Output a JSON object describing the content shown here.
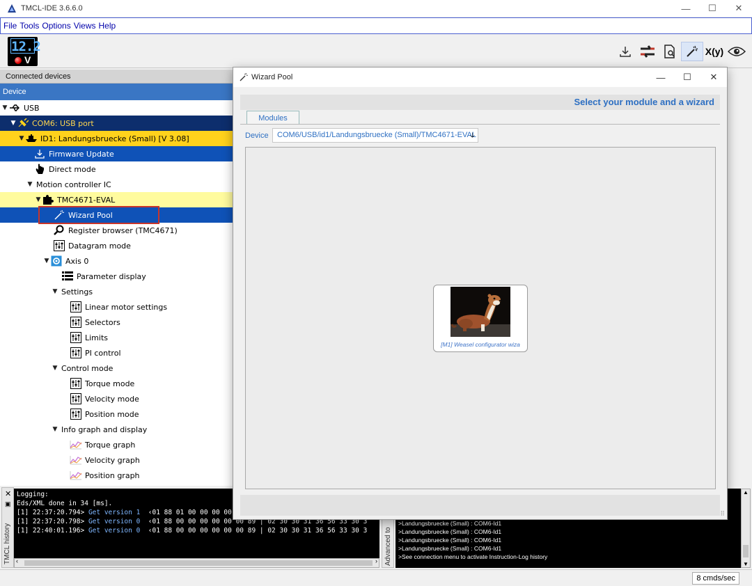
{
  "window": {
    "title": "TMCL-IDE 3.6.6.0",
    "controls": {
      "minimize": "—",
      "maximize": "☐",
      "close": "✕"
    }
  },
  "menu": [
    "File",
    "Tools",
    "Options",
    "Views",
    "Help"
  ],
  "toolbar": {
    "voltage_display": "12.2",
    "voltage_unit": "V",
    "xy_label": "X(y)"
  },
  "left_panel": {
    "header": "Connected devices",
    "column_header": "Device",
    "tree": {
      "usb": "USB",
      "com_port": "COM6: USB port",
      "module": "ID1: Landungsbruecke (Small) [V 3.08]",
      "firmware_update": "Firmware Update",
      "direct_mode": "Direct mode",
      "motion_controller": "Motion controller IC",
      "eval": "TMC4671-EVAL",
      "wizard_pool": "Wizard Pool",
      "register_browser": "Register browser (TMC4671)",
      "datagram_mode": "Datagram mode",
      "axis": "Axis 0",
      "parameter_display": "Parameter display",
      "settings": "Settings",
      "linear_motor": "Linear motor settings",
      "selectors": "Selectors",
      "limits": "Limits",
      "pi_control": "PI control",
      "control_mode": "Control mode",
      "torque_mode": "Torque mode",
      "velocity_mode": "Velocity mode",
      "position_mode": "Position mode",
      "info_graph": "Info graph and display",
      "torque_graph": "Torque graph",
      "velocity_graph": "Velocity graph",
      "position_graph": "Position graph"
    }
  },
  "dialog": {
    "title": "Wizard Pool",
    "banner": "Select your module and a wizard",
    "tab": "Modules",
    "device_label": "Device",
    "device_value": "COM6/USB/id1/Landungsbruecke (Small)/TMC4671-EVAL",
    "wizard_caption": "[M1] Weasel configurator wiza"
  },
  "history": {
    "tab_label": "TMCL history",
    "lines": [
      {
        "text": "Logging:"
      },
      {
        "text": "Eds/XML done in 34 [ms]."
      },
      {
        "prefix": "[1] 22:37:20.794> ",
        "cmd": "Get version 1",
        "data": "  ‹01 88 01 00 00 00 00 00 8a | 02 30 30 31 36 56 33 30 3"
      },
      {
        "prefix": "[1] 22:37:20.798> ",
        "cmd": "Get version 0",
        "data": "  ‹01 88 00 00 00 00 00 00 89 | 02 30 30 31 36 56 33 30 3"
      },
      {
        "prefix": "[1] 22:40:01.196> ",
        "cmd": "Get version 0",
        "data": "  ‹01 88 00 00 00 00 00 00 89 | 02 30 30 31 36 56 33 30 3"
      }
    ]
  },
  "advanced": {
    "tab_label": "Advanced to",
    "lines": [
      ">Landungsbruecke (Small) : COM6-Id1",
      ">Landungsbruecke (Small) : COM6-Id1",
      ">Landungsbruecke (Small) : COM6-Id1",
      ">Landungsbruecke (Small) : COM6-Id1",
      ">See connection menu to activate Instruction-Log history"
    ]
  },
  "status": {
    "rate": "8 cmds/sec"
  },
  "colors": {
    "selection_blue": "#0f52b7",
    "selection_navy": "#0d2e6d",
    "selection_gold": "#ffd21c",
    "selection_yellow": "#fffb9e",
    "accent": "#2d6fc2",
    "highlight_border": "#c8352a"
  },
  "icons": {
    "app": "tmcl-logo-icon",
    "download": "download-icon",
    "swap": "swap-arrows-icon",
    "file_search": "file-search-icon",
    "wand": "magic-wand-icon",
    "eye": "eye-icon"
  }
}
